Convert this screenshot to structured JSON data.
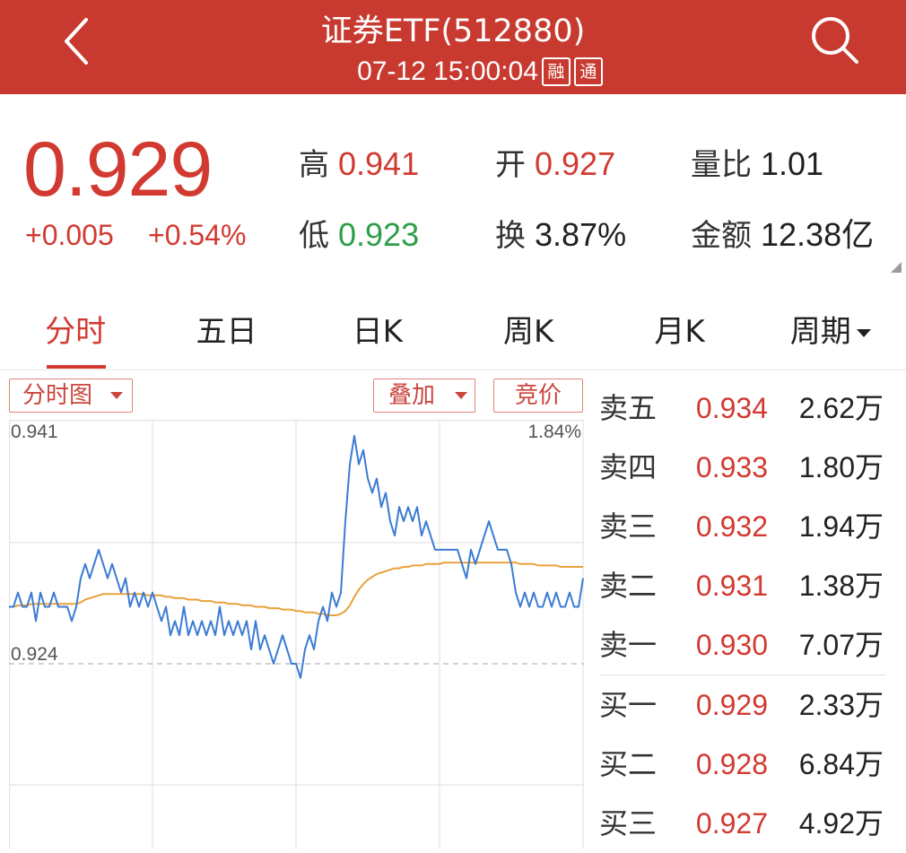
{
  "header": {
    "back_icon": "chevron-left-icon",
    "title": "证券ETF(512880)",
    "datetime": "07-12 15:00:04",
    "badges": [
      "融",
      "通"
    ],
    "search_icon": "search-icon"
  },
  "quote": {
    "price": "0.929",
    "change": "+0.005",
    "change_pct": "+0.54%",
    "stats": [
      {
        "label": "高",
        "value": "0.941",
        "color": "#d23a31"
      },
      {
        "label": "开",
        "value": "0.927",
        "color": "#d23a31"
      },
      {
        "label": "量比",
        "value": "1.01",
        "color": "#222222"
      },
      {
        "label": "低",
        "value": "0.923",
        "color": "#2f9e48"
      },
      {
        "label": "换",
        "value": "3.87%",
        "color": "#222222"
      },
      {
        "label": "金额",
        "value": "12.38亿",
        "color": "#222222"
      }
    ],
    "expand_icon": "corner-triangle-icon"
  },
  "tabs": [
    {
      "label": "分时",
      "active": true
    },
    {
      "label": "五日",
      "active": false
    },
    {
      "label": "日K",
      "active": false
    },
    {
      "label": "周K",
      "active": false
    },
    {
      "label": "月K",
      "active": false
    },
    {
      "label": "周期",
      "active": false,
      "icon": "caret-down-icon"
    }
  ],
  "chart_controls": {
    "type_select": "分时图",
    "overlay_select": "叠加",
    "auction_button": "竞价"
  },
  "chart_data": {
    "type": "line",
    "y_labels": {
      "top": "0.941",
      "prev_close": "0.924",
      "top_pct": "1.84%"
    },
    "ylim": [
      0.907,
      0.941
    ],
    "grid": true,
    "series": [
      {
        "color": "#3b7bd4",
        "values": [
          0.928,
          0.928,
          0.929,
          0.928,
          0.928,
          0.929,
          0.927,
          0.929,
          0.928,
          0.928,
          0.929,
          0.928,
          0.928,
          0.928,
          0.927,
          0.928,
          0.93,
          0.931,
          0.93,
          0.931,
          0.932,
          0.931,
          0.93,
          0.931,
          0.93,
          0.929,
          0.93,
          0.928,
          0.929,
          0.928,
          0.929,
          0.928,
          0.929,
          0.928,
          0.927,
          0.928,
          0.926,
          0.927,
          0.926,
          0.928,
          0.926,
          0.927,
          0.926,
          0.927,
          0.926,
          0.927,
          0.926,
          0.928,
          0.926,
          0.927,
          0.926,
          0.927,
          0.926,
          0.927,
          0.925,
          0.927,
          0.925,
          0.926,
          0.925,
          0.924,
          0.925,
          0.926,
          0.925,
          0.924,
          0.924,
          0.923,
          0.925,
          0.926,
          0.925,
          0.927,
          0.928,
          0.927,
          0.929,
          0.928,
          0.929,
          0.934,
          0.938,
          0.94,
          0.938,
          0.939,
          0.937,
          0.936,
          0.937,
          0.935,
          0.936,
          0.934,
          0.933,
          0.935,
          0.934,
          0.935,
          0.934,
          0.935,
          0.933,
          0.934,
          0.933,
          0.932,
          0.932,
          0.932,
          0.932,
          0.932,
          0.932,
          0.931,
          0.93,
          0.932,
          0.931,
          0.932,
          0.933,
          0.934,
          0.933,
          0.932,
          0.932,
          0.932,
          0.931,
          0.929,
          0.928,
          0.929,
          0.928,
          0.929,
          0.928,
          0.928,
          0.929,
          0.928,
          0.929,
          0.928,
          0.928,
          0.929,
          0.928,
          0.928,
          0.93
        ]
      },
      {
        "color": "#e8a23a",
        "values": [
          0.928,
          0.928,
          0.9281,
          0.9281,
          0.9281,
          0.9282,
          0.9282,
          0.9282,
          0.9282,
          0.9282,
          0.9282,
          0.9282,
          0.9282,
          0.9282,
          0.9282,
          0.9282,
          0.9283,
          0.9285,
          0.9286,
          0.9287,
          0.9288,
          0.9289,
          0.9289,
          0.9289,
          0.9289,
          0.9289,
          0.9289,
          0.9289,
          0.9289,
          0.9289,
          0.9289,
          0.9288,
          0.9288,
          0.9288,
          0.9288,
          0.9287,
          0.9287,
          0.9286,
          0.9286,
          0.9286,
          0.9285,
          0.9285,
          0.9285,
          0.9284,
          0.9284,
          0.9284,
          0.9283,
          0.9283,
          0.9283,
          0.9282,
          0.9282,
          0.9282,
          0.9281,
          0.9281,
          0.9281,
          0.928,
          0.928,
          0.928,
          0.9279,
          0.9279,
          0.9279,
          0.9278,
          0.9278,
          0.9278,
          0.9277,
          0.9277,
          0.9276,
          0.9276,
          0.9276,
          0.9275,
          0.9275,
          0.9274,
          0.9274,
          0.9274,
          0.9275,
          0.9277,
          0.9281,
          0.9287,
          0.9292,
          0.9296,
          0.9299,
          0.9301,
          0.9303,
          0.9304,
          0.9305,
          0.9306,
          0.9307,
          0.9307,
          0.9308,
          0.9308,
          0.9309,
          0.9309,
          0.9309,
          0.931,
          0.931,
          0.931,
          0.931,
          0.9311,
          0.9311,
          0.9311,
          0.9311,
          0.9311,
          0.9311,
          0.9311,
          0.9311,
          0.9311,
          0.9311,
          0.9311,
          0.9311,
          0.9311,
          0.9311,
          0.9311,
          0.9311,
          0.9311,
          0.931,
          0.931,
          0.931,
          0.931,
          0.9309,
          0.9309,
          0.9309,
          0.9309,
          0.9309,
          0.9308,
          0.9308,
          0.9308,
          0.9308,
          0.9308,
          0.9308
        ]
      }
    ]
  },
  "order_book": {
    "asks": [
      {
        "label": "卖五",
        "price": "0.934",
        "volume": "2.62万"
      },
      {
        "label": "卖四",
        "price": "0.933",
        "volume": "1.80万"
      },
      {
        "label": "卖三",
        "price": "0.932",
        "volume": "1.94万"
      },
      {
        "label": "卖二",
        "price": "0.931",
        "volume": "1.38万"
      },
      {
        "label": "卖一",
        "price": "0.930",
        "volume": "7.07万"
      }
    ],
    "bids": [
      {
        "label": "买一",
        "price": "0.929",
        "volume": "2.33万"
      },
      {
        "label": "买二",
        "price": "0.928",
        "volume": "6.84万"
      },
      {
        "label": "买三",
        "price": "0.927",
        "volume": "4.92万"
      }
    ]
  },
  "colors": {
    "header_bg": "#c83a30",
    "up": "#d23a31",
    "down": "#2f9e48",
    "price_line": "#3b7bd4",
    "avg_line": "#e8a23a"
  }
}
